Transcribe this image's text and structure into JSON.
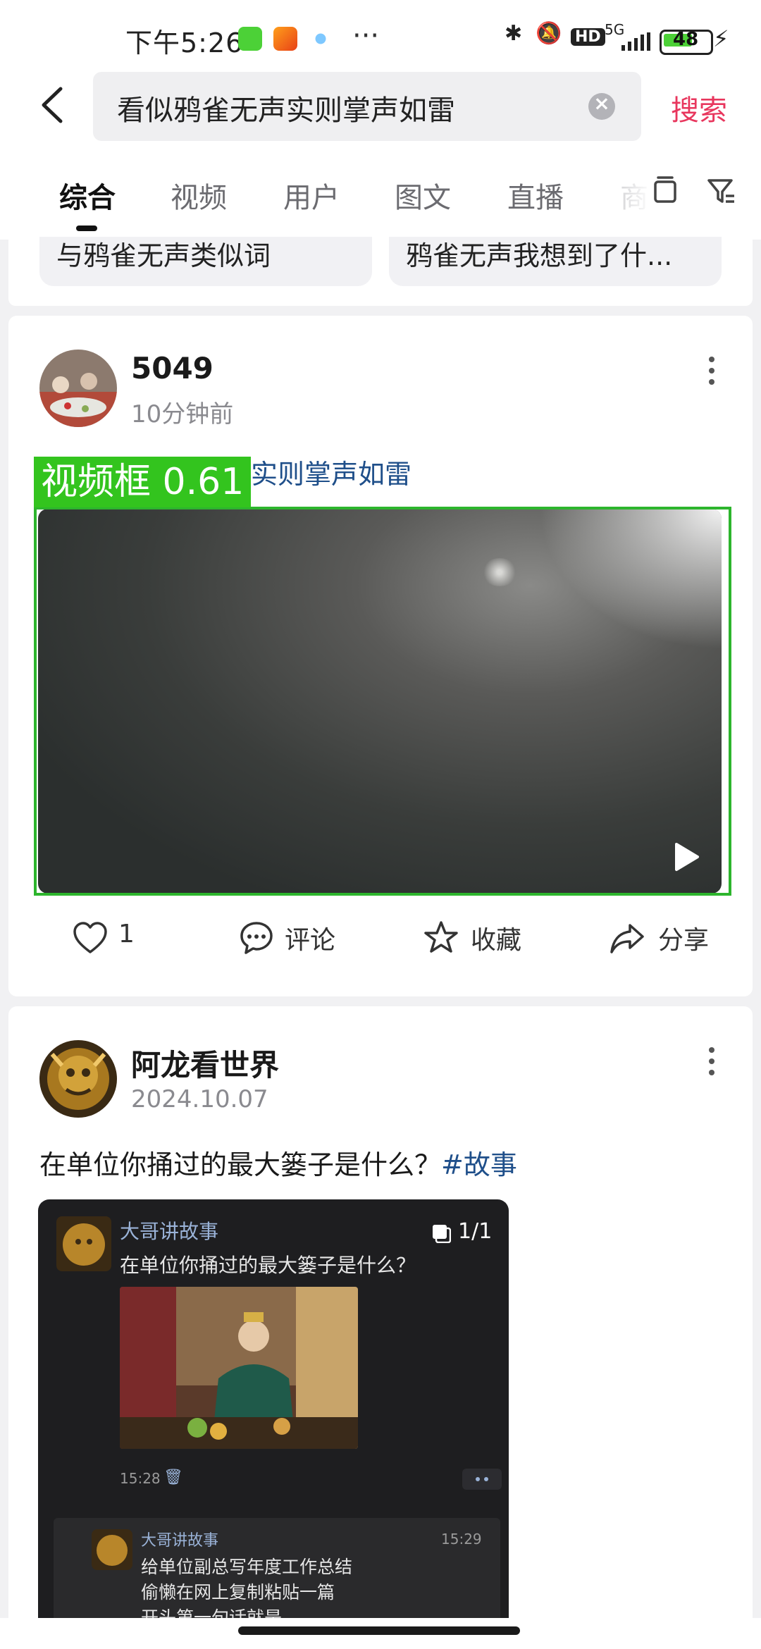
{
  "status_bar": {
    "time": "下午5:26",
    "more": "···",
    "signal": "5G",
    "hd": "HD",
    "battery": "48"
  },
  "header": {
    "search_query": "看似鸦雀无声实则掌声如雷",
    "search_button": "搜索"
  },
  "tabs": [
    {
      "label": "综合",
      "active": true
    },
    {
      "label": "视频",
      "active": false
    },
    {
      "label": "用户",
      "active": false
    },
    {
      "label": "图文",
      "active": false
    },
    {
      "label": "直播",
      "active": false
    },
    {
      "label": "商",
      "active": false
    }
  ],
  "suggestions": [
    {
      "text": "与鸦雀无声类似词"
    },
    {
      "text": "鸦雀无声我想到了什..."
    }
  ],
  "posts": [
    {
      "author": "5049",
      "time": "10分钟前",
      "title_visible": "实则掌声如雷",
      "detection_label": "视频框 0.61",
      "actions": {
        "like_count": "1",
        "comment": "评论",
        "favorite": "收藏",
        "share": "分享"
      }
    },
    {
      "author": "阿龙看世界",
      "time": "2024.10.07",
      "text": "在单位你捅过的最大篓子是什么？",
      "hashtag": "#故事",
      "embedded": {
        "name": "大哥讲故事",
        "question": "在单位你捅过的最大篓子是什么？",
        "counter": "1/1",
        "msg_time": "15:28",
        "reply_name": "大哥讲故事",
        "reply_time": "15:29",
        "reply_lines": [
          "给单位副总写年度工作总结",
          "偷懒在网上复制粘贴一篇",
          "开头第一句话就是"
        ]
      }
    }
  ],
  "colors": {
    "accent": "#e8365d",
    "hashtag": "#1f4f8a",
    "detect": "#33c41e"
  }
}
